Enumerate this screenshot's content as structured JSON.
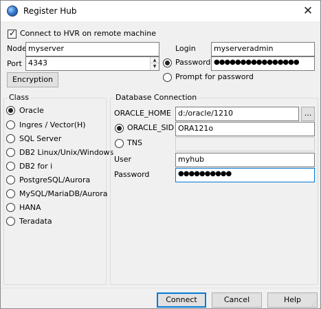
{
  "window": {
    "title": "Register Hub",
    "close_glyph": "✕",
    "icon": "globe-icon"
  },
  "remote": {
    "connect_checkbox_label": "Connect to HVR on remote machine",
    "connect_checked": true,
    "node_label": "Node",
    "node_value": "myserver",
    "port_label": "Port",
    "port_value": "4343",
    "login_label": "Login",
    "login_value": "myserveradmin",
    "password_label": "Password",
    "password_value": "●●●●●●●●●●●●●●●●",
    "prompt_label": "Prompt for password",
    "password_mode_selected": "Password",
    "encryption_button": "Encryption"
  },
  "class_group": {
    "title": "Class",
    "options": [
      "Oracle",
      "Ingres / Vector(H)",
      "SQL Server",
      "DB2 Linux/Unix/Windows",
      "DB2 for i",
      "PostgreSQL/Aurora",
      "MySQL/MariaDB/Aurora",
      "HANA",
      "Teradata"
    ],
    "selected": "Oracle"
  },
  "db": {
    "title": "Database Connection",
    "oracle_home_label": "ORACLE_HOME",
    "oracle_home_value": "d:/oracle/1210",
    "browse_label": "...",
    "oracle_sid_label": "ORACLE_SID",
    "oracle_sid_value": "ORA121o",
    "tns_label": "TNS",
    "tns_value": "",
    "selected_mode": "ORACLE_SID",
    "user_label": "User",
    "user_value": "myhub",
    "password_label": "Password",
    "password_value": "●●●●●●●●●●"
  },
  "buttons": {
    "connect": "Connect",
    "cancel": "Cancel",
    "help": "Help"
  },
  "colors": {
    "focus": "#0078d7",
    "dialog_bg": "#f0f0f0"
  }
}
